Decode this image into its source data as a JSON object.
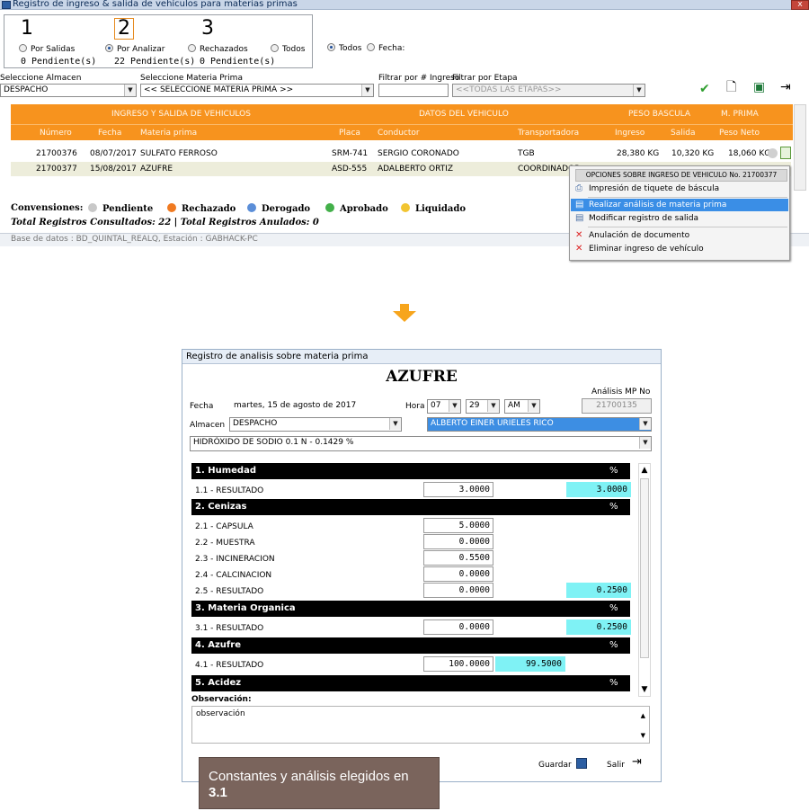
{
  "window": {
    "title": "Registro de ingreso & salida de vehículos para materias primas",
    "close_label": "x"
  },
  "steps": [
    {
      "number": "1",
      "label": "Por Salidas",
      "pending": "0 Pendiente(s)"
    },
    {
      "number": "2",
      "label": "Por Analizar",
      "pending": "22 Pendiente(s)"
    },
    {
      "number": "3",
      "label": "Rechazados",
      "pending": "0 Pendiente(s)"
    },
    {
      "label": "Todos"
    }
  ],
  "date_filter": {
    "all_label": "Todos",
    "date_label": "Fecha:"
  },
  "filters": {
    "almacen_label": "Seleccione Almacen",
    "almacen_value": "DESPACHO",
    "materia_label": "Seleccione Materia Prima",
    "materia_value": "<< SELECCIONE MATERIA PRIMA >>",
    "ingreso_label": "Filtrar por # Ingreso",
    "ingreso_value": "",
    "etapa_label": "Filtrar por Etapa",
    "etapa_value": "<<TODAS LAS ETAPAS>>"
  },
  "grid": {
    "groups": [
      "INGRESO Y SALIDA DE VEHICULOS",
      "DATOS DEL VEHICULO",
      "PESO BASCULA",
      "M. PRIMA"
    ],
    "columns": [
      "Número",
      "Fecha",
      "Materia prima",
      "Placa",
      "Conductor",
      "Transportadora",
      "Ingreso",
      "Salida",
      "Peso Neto"
    ],
    "rows": [
      {
        "numero": "21700376",
        "fecha": "08/07/2017",
        "materia": "SULFATO FERROSO",
        "placa": "SRM-741",
        "conductor": "SERGIO CORONADO",
        "transportadora": "TGB",
        "ingreso": "28,380 KG",
        "salida": "10,320 KG",
        "neto": "18,060 KG"
      },
      {
        "numero": "21700377",
        "fecha": "15/08/2017",
        "materia": "AZUFRE",
        "placa": "ASD-555",
        "conductor": "ADALBERTO ORTIZ",
        "transportadora": "COORDINADOR",
        "ingreso": "",
        "salida": "",
        "neto": ""
      }
    ]
  },
  "conventions": {
    "label": "Convensiones:",
    "items": [
      {
        "label": "Pendiente",
        "color": "#c8c8c8"
      },
      {
        "label": "Rechazado",
        "color": "#f07a21"
      },
      {
        "label": "Derogado",
        "color": "#5b8ed8"
      },
      {
        "label": "Aprobado",
        "color": "#43b04a"
      },
      {
        "label": "Liquidado",
        "color": "#f2c531"
      }
    ]
  },
  "totals": "Total Registros Consultados: 22 | Total Registros Anulados: 0",
  "status": "Base de datos : BD_QUINTAL_REALQ, Estación : GABHACK-PC",
  "context_menu": {
    "header": "OPCIONES SOBRE INGRESO DE VEHICULO No. 21700377",
    "items": [
      "Impresión de tiquete de báscula",
      "Realizar análisis de materia prima",
      "Modificar registro de salida",
      "Anulación de documento",
      "Eliminar ingreso de vehículo"
    ]
  },
  "dialog": {
    "title": "Registro de analisis sobre materia prima",
    "material": "AZUFRE",
    "fecha_label": "Fecha",
    "fecha_value": "martes, 15 de agosto de 2017",
    "hora_label": "Hora",
    "hora_h": "07",
    "hora_m": "29",
    "hora_ampm": "AM",
    "analisis_label": "Análisis MP No",
    "analisis_value": "21700135",
    "almacen_label": "Almacen",
    "almacen_value": "DESPACHO",
    "analista_value": "ALBERTO EINER URIELES RICO",
    "reactivo_value": "HIDRÓXIDO DE SODIO 0.1 N - 0.1429 %",
    "sections": [
      {
        "title": "1. Humedad",
        "pct": "%"
      },
      {
        "title": "2. Cenizas",
        "pct": "%"
      },
      {
        "title": "3. Materia Organica",
        "pct": "%"
      },
      {
        "title": "4. Azufre",
        "pct": "%"
      },
      {
        "title": "5. Acidez",
        "pct": "%"
      }
    ],
    "rows": [
      {
        "label": "1.1 - RESULTADO",
        "value": "3.0000",
        "result": "3.0000"
      },
      {
        "label": "2.1 - CAPSULA",
        "value": "5.0000"
      },
      {
        "label": "2.2 - MUESTRA",
        "value": "0.0000"
      },
      {
        "label": "2.3 - INCINERACION",
        "value": "0.5500"
      },
      {
        "label": "2.4 - CALCINACION",
        "value": "0.0000"
      },
      {
        "label": "2.5 - RESULTADO",
        "value": "0.0000",
        "result": "0.2500"
      },
      {
        "label": "3.1 - RESULTADO",
        "value": "0.0000",
        "result": "0.2500"
      },
      {
        "label": "4.1 - RESULTADO",
        "value": "100.0000",
        "result": "99.5000"
      }
    ],
    "obs_label": "Observación:",
    "obs_value": "observación",
    "save_label": "Guardar",
    "exit_label": "Salir"
  },
  "caption": {
    "text": "Constantes y análisis elegidos en ",
    "bold": "3.1"
  }
}
